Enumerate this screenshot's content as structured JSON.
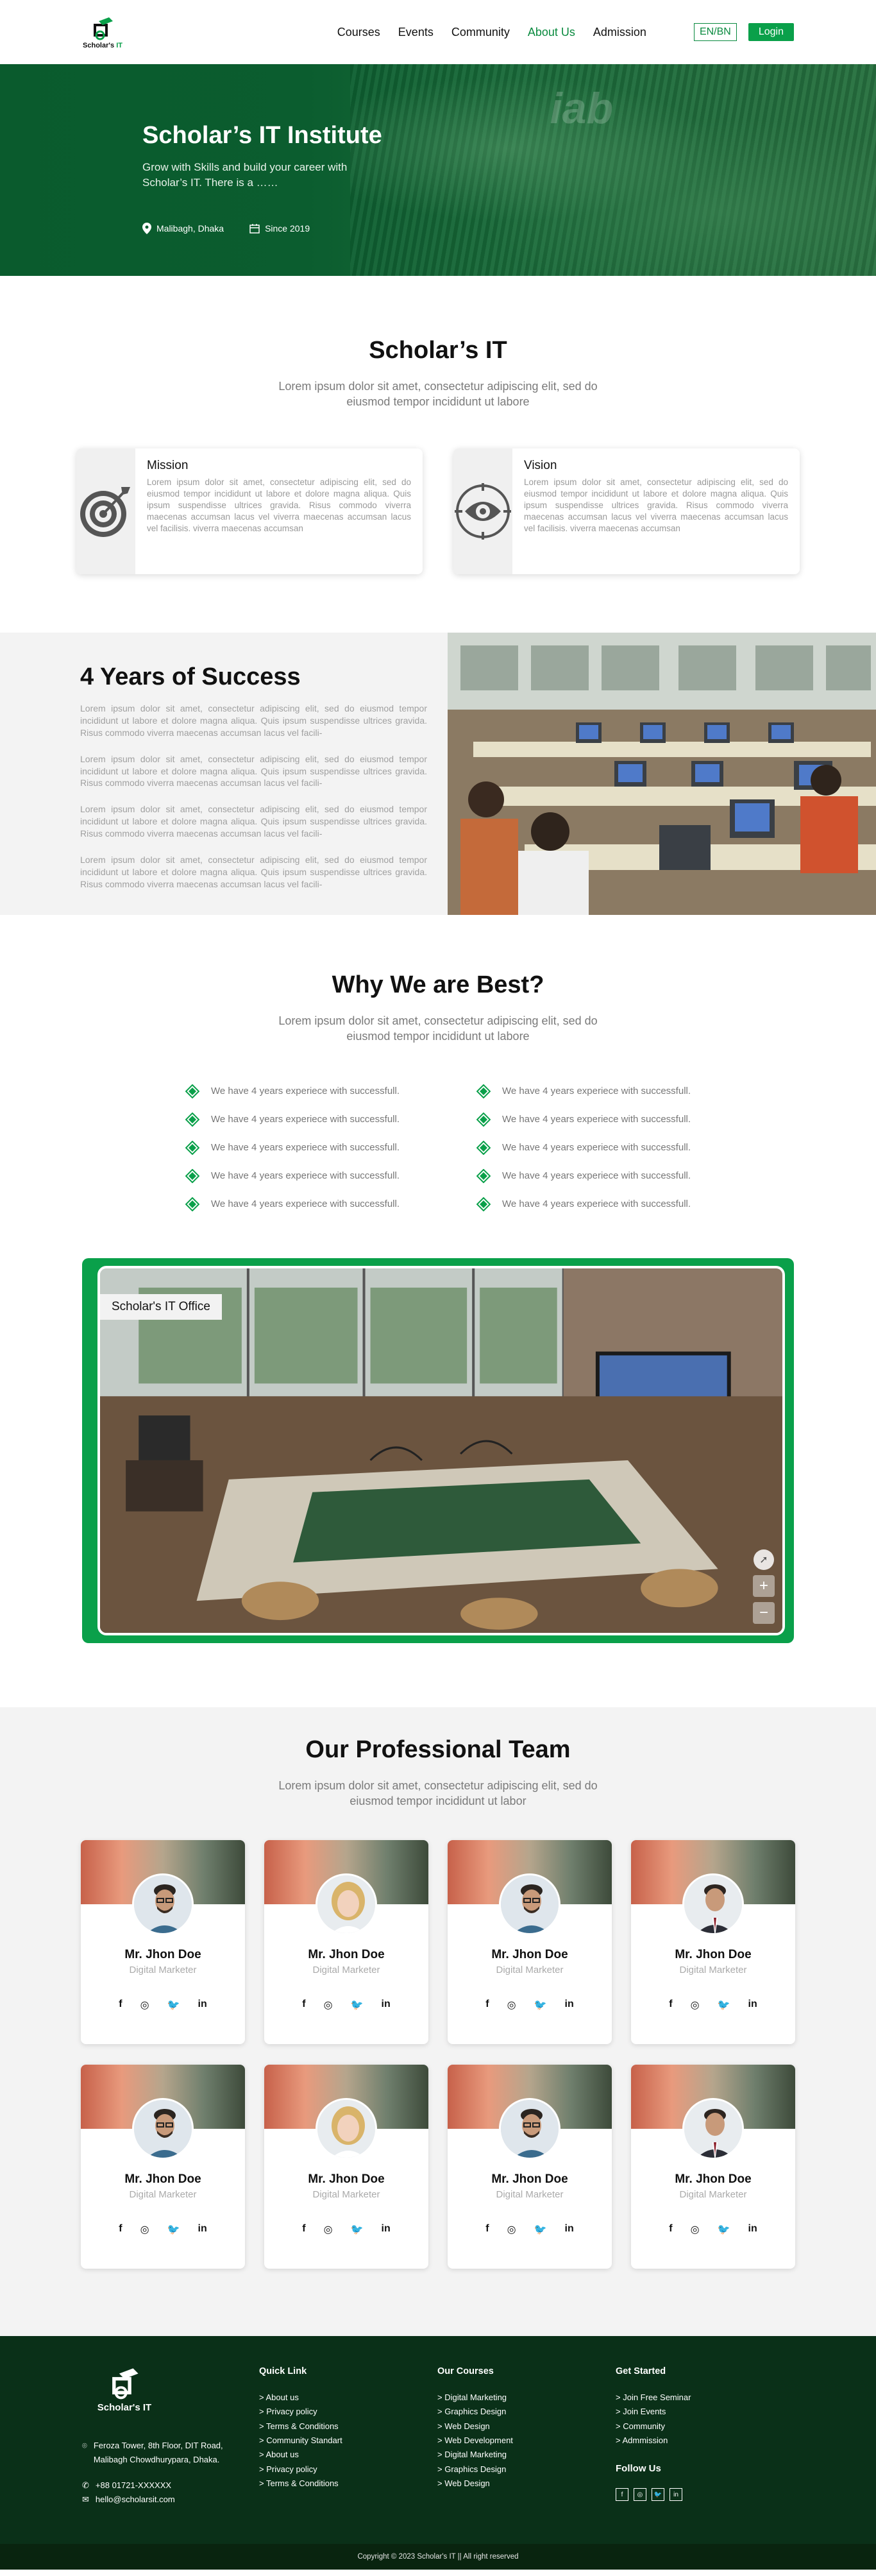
{
  "brand": {
    "name_prefix": "Scholar's",
    "name_suffix": "IT"
  },
  "nav": {
    "links": [
      "Courses",
      "Events",
      "Community",
      "About Us",
      "Admission"
    ],
    "active": "About Us",
    "lang_label": "EN/BN",
    "login_label": "Login"
  },
  "hero": {
    "title": "Scholar’s IT Institute",
    "subtitle": "Grow with Skills and build your career with Scholar’s IT. There is a ……",
    "location": "Malibagh, Dhaka",
    "since": "Since 2019"
  },
  "about": {
    "title": "Scholar’s IT",
    "subtitle": "Lorem ipsum dolor sit amet, consectetur adipiscing elit, sed do eiusmod tempor incididunt ut labore",
    "cards": [
      {
        "title": "Mission",
        "icon": "target-icon",
        "text": "Lorem ipsum dolor sit amet, consectetur adipiscing elit, sed do eiusmod tempor incididunt ut labore et dolore magna aliqua. Quis ipsum suspendisse ultrices gravida. Risus commodo viverra maecenas accumsan lacus vel viverra maecenas accumsan lacus vel facilisis. viverra maecenas accumsan"
      },
      {
        "title": "Vision",
        "icon": "eye-icon",
        "text": "Lorem ipsum dolor sit amet, consectetur adipiscing elit, sed do eiusmod tempor incididunt ut labore et dolore magna aliqua. Quis ipsum suspendisse ultrices gravida. Risus commodo viverra maecenas accumsan lacus vel viverra maecenas accumsan lacus vel facilisis. viverra maecenas accumsan"
      }
    ]
  },
  "success": {
    "title": "4 Years of Success",
    "paragraphs": [
      "Lorem ipsum dolor sit amet, consectetur adipiscing elit, sed do eiusmod tempor incididunt ut labore et dolore magna aliqua. Quis ipsum suspendisse ultrices gravida. Risus commodo viverra maecenas accumsan lacus vel facili-",
      "Lorem ipsum dolor sit amet, consectetur adipiscing elit, sed do eiusmod tempor incididunt ut labore et dolore magna aliqua. Quis ipsum suspendisse ultrices gravida. Risus commodo viverra maecenas accumsan lacus vel facili-",
      "Lorem ipsum dolor sit amet, consectetur adipiscing elit, sed do eiusmod tempor incididunt ut labore et dolore magna aliqua. Quis ipsum suspendisse ultrices gravida. Risus commodo viverra maecenas accumsan lacus vel facili-",
      "Lorem ipsum dolor sit amet, consectetur adipiscing elit, sed do eiusmod tempor incididunt ut labore et dolore magna aliqua. Quis ipsum suspendisse ultrices gravida. Risus commodo viverra maecenas accumsan lacus vel facili-"
    ]
  },
  "why": {
    "title": "Why We are Best?",
    "subtitle": "Lorem ipsum dolor sit amet, consectetur adipiscing elit, sed do eiusmod tempor incididunt ut labore",
    "left": [
      "We have 4 years experiece with successfull.",
      "We have 4 years experiece with successfull.",
      "We have 4 years experiece with successfull.",
      "We have 4 years experiece with successfull.",
      "We have 4 years experiece with successfull."
    ],
    "right": [
      "We have 4 years experiece with successfull.",
      "We have 4 years experiece with successfull.",
      "We have 4 years experiece with successfull.",
      "We have 4 years experiece with successfull.",
      "We have 4 years experiece with successfull."
    ]
  },
  "office": {
    "label": "Scholar's IT Office",
    "zoom_in": "+",
    "zoom_out": "−"
  },
  "team": {
    "title": "Our Professional Team",
    "subtitle": "Lorem ipsum dolor sit amet, consectetur adipiscing elit, sed do eiusmod tempor incididunt ut labor",
    "members": [
      {
        "name": "Mr. Jhon Doe",
        "role": "Digital Marketer",
        "avatar": "man-glasses"
      },
      {
        "name": "Mr. Jhon Doe",
        "role": "Digital Marketer",
        "avatar": "woman-blonde"
      },
      {
        "name": "Mr. Jhon Doe",
        "role": "Digital Marketer",
        "avatar": "man-glasses"
      },
      {
        "name": "Mr. Jhon Doe",
        "role": "Digital Marketer",
        "avatar": "man-suit"
      },
      {
        "name": "Mr. Jhon Doe",
        "role": "Digital Marketer",
        "avatar": "man-glasses"
      },
      {
        "name": "Mr. Jhon Doe",
        "role": "Digital Marketer",
        "avatar": "woman-blonde"
      },
      {
        "name": "Mr. Jhon Doe",
        "role": "Digital Marketer",
        "avatar": "man-glasses"
      },
      {
        "name": "Mr. Jhon Doe",
        "role": "Digital Marketer",
        "avatar": "man-suit"
      }
    ],
    "social": [
      "f",
      "◎",
      "🐦",
      "in"
    ]
  },
  "footer": {
    "brand": "Scholar's IT",
    "address": "Feroza Tower, 8th Floor, DIT Road, Malibagh Chowdhurypara, Dhaka.",
    "phone": "+88 01721-XXXXXX",
    "email": "hello@scholarsit.com",
    "quick_link": {
      "title": "Quick Link",
      "items": [
        "About us",
        "Privacy policy",
        "Terms & Conditions",
        "Community Standart",
        "About us",
        "Privacy policy",
        "Terms & Conditions"
      ]
    },
    "courses": {
      "title": "Our Courses",
      "items": [
        "Digital Marketing",
        "Graphics Design",
        "Web Design",
        "Web Development",
        "Digital Marketing",
        "Graphics Design",
        "Web Design"
      ]
    },
    "get_started": {
      "title": "Get Started",
      "items": [
        "Join Free Seminar",
        "Join Events",
        "Community",
        "Admmission"
      ]
    },
    "follow_title": "Follow Us",
    "follow_icons": [
      "f",
      "◎",
      "🐦",
      "in"
    ],
    "copyright": "Copyright © 2023 Scholar's IT || All right reserved"
  },
  "colors": {
    "primary": "#0aa04a",
    "dark_green": "#0a3018",
    "hero_green": "#0b5d2f"
  }
}
